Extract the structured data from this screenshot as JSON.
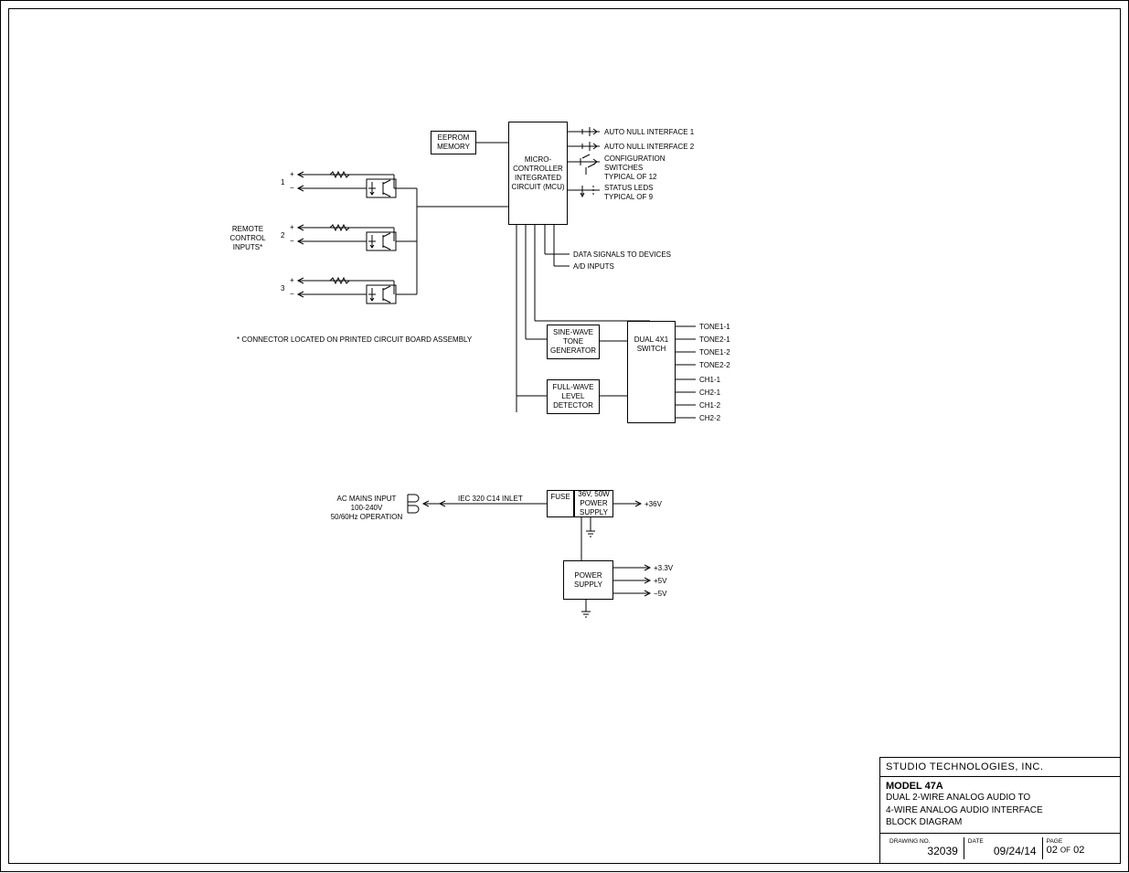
{
  "blocks": {
    "eeprom": "EEPROM\nMEMORY",
    "mcu": "MICRO-\nCONTROLLER\nINTEGRATED\nCIRCUIT\n(MCU)",
    "sine": "SINE-WAVE\nTONE\nGENERATOR",
    "detector": "FULL-WAVE\nLEVEL\nDETECTOR",
    "switch": "DUAL\n4X1\nSWITCH",
    "fuse": "FUSE",
    "psu36": "36V,\n50W\nPOWER\nSUPPLY",
    "psu2": "POWER\nSUPPLY"
  },
  "labels": {
    "remote": "REMOTE\nCONTROL\nINPUTS*",
    "ch1": "1",
    "ch2": "2",
    "ch3": "3",
    "plus": "+",
    "minus": "−",
    "note": "* CONNECTOR LOCATED ON PRINTED CIRCUIT BOARD ASSEMBLY",
    "auto1": "AUTO NULL INTERFACE 1",
    "auto2": "AUTO NULL INTERFACE 2",
    "config": "CONFIGURATION\nSWITCHES\nTYPICAL OF 12",
    "leds": "STATUS LEDS\nTYPICAL OF 9",
    "data": "DATA SIGNALS TO DEVICES",
    "ad": "A/D INPUTS",
    "tone11": "TONE1-1",
    "tone21": "TONE2-1",
    "tone12": "TONE1-2",
    "tone22": "TONE2-2",
    "ch1_1": "CH1-1",
    "ch2_1": "CH2-1",
    "ch1_2": "CH1-2",
    "ch2_2": "CH2-2",
    "acmains": "AC MAINS INPUT\n100-240V\n50/60Hz OPERATION",
    "iec": "IEC 320 C14 INLET",
    "v36": "+36V",
    "v33": "+3.3V",
    "v5": "+5V",
    "vm5": "−5V"
  },
  "titleblock": {
    "company": "STUDIO TECHNOLOGIES, INC.",
    "model": "MODEL 47A",
    "desc1": "DUAL 2-WIRE ANALOG AUDIO TO",
    "desc2": "4-WIRE ANALOG AUDIO INTERFACE",
    "desc3": "BLOCK DIAGRAM",
    "drawingno_hdr": "DRAWING NO.",
    "drawingno": "32039",
    "date_hdr": "DATE",
    "date": "09/24/14",
    "page_hdr": "PAGE",
    "page": "02",
    "of": "OF",
    "pages": "02"
  }
}
